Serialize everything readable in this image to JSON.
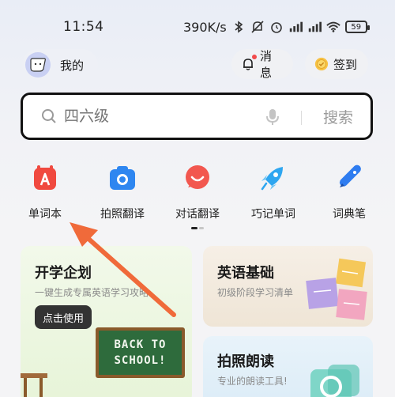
{
  "status_bar": {
    "time": "11:54",
    "speed": "390K/s",
    "battery": "59"
  },
  "header": {
    "profile_label": "我的",
    "message_label": "消息",
    "signin_label": "签到"
  },
  "search": {
    "placeholder": "四六级",
    "button_label": "搜索"
  },
  "tools": [
    {
      "label": "单词本",
      "icon": "wordbook-icon"
    },
    {
      "label": "拍照翻译",
      "icon": "camera-icon"
    },
    {
      "label": "对话翻译",
      "icon": "chat-icon"
    },
    {
      "label": "巧记单词",
      "icon": "rocket-icon"
    },
    {
      "label": "词典笔",
      "icon": "pen-icon"
    }
  ],
  "cards": {
    "left": {
      "title": "开学企划",
      "subtitle": "一键生成专属英语学习攻略",
      "button": "点击使用",
      "board_line1": "BACK TO",
      "board_line2": "SCHOOL!"
    },
    "top_right": {
      "title": "英语基础",
      "subtitle": "初级阶段学习清单"
    },
    "bottom_right": {
      "title": "拍照朗读",
      "subtitle": "专业的朗读工具!"
    }
  },
  "colors": {
    "accent_arrow": "#f06a3a",
    "search_border": "#111111",
    "dark_button": "#333333"
  }
}
